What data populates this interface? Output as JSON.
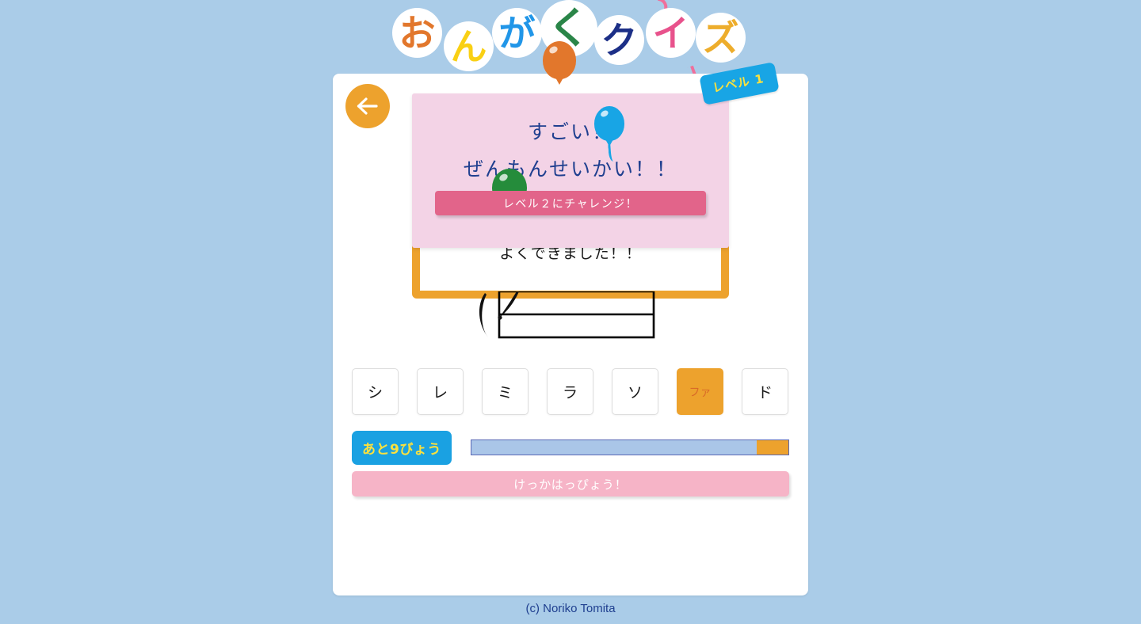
{
  "app": {
    "title_characters": [
      {
        "char": "お",
        "color": "#e2772c"
      },
      {
        "char": "ん",
        "color": "#f9d014"
      },
      {
        "char": "が",
        "color": "#2196e8"
      },
      {
        "char": "く",
        "color": "#2a8548"
      },
      {
        "char": "ク",
        "color": "#1c2f87"
      },
      {
        "char": "イ",
        "color": "#e8528c"
      },
      {
        "char": "ズ",
        "color": "#edad2c"
      }
    ],
    "title_text": "おんがくクイズ"
  },
  "header": {
    "back_button_icon": "arrow-left-icon",
    "level_badge": "レベル 1"
  },
  "question": {
    "feedback_text": "よくできました！！",
    "staff_icon": "music-staff-treble-clef"
  },
  "notes": {
    "buttons": [
      {
        "label": "シ",
        "selected": false
      },
      {
        "label": "レ",
        "selected": false
      },
      {
        "label": "ミ",
        "selected": false
      },
      {
        "label": "ラ",
        "selected": false
      },
      {
        "label": "ソ",
        "selected": false
      },
      {
        "label": "ファ",
        "selected": true
      },
      {
        "label": "ド",
        "selected": false
      }
    ]
  },
  "timer": {
    "badge_text": "あと9びょう",
    "seconds_remaining": 9,
    "progress_percent": 90
  },
  "actions": {
    "result_button": "けっかはっぴょう！"
  },
  "modal": {
    "line1": "すごい！",
    "line2": "ぜんもんせいかい！！",
    "challenge_button": "レベル２にチャレンジ！",
    "balloons": [
      {
        "name": "blue-balloon",
        "color": "#18a5e5"
      },
      {
        "name": "green-balloon",
        "color": "#258c3b"
      }
    ]
  },
  "footer": {
    "copyright": "(c) Noriko Tomita"
  },
  "colors": {
    "page_background": "#aacce8",
    "card_background": "#ffffff",
    "accent_orange": "#eda22d",
    "accent_blue": "#18a5e5",
    "accent_pink": "#f6b4c7",
    "modal_background": "#f3d3e6",
    "modal_button": "#e2648a",
    "text_navy": "#1f3f8f",
    "badge_yellow": "#fbe13e"
  }
}
